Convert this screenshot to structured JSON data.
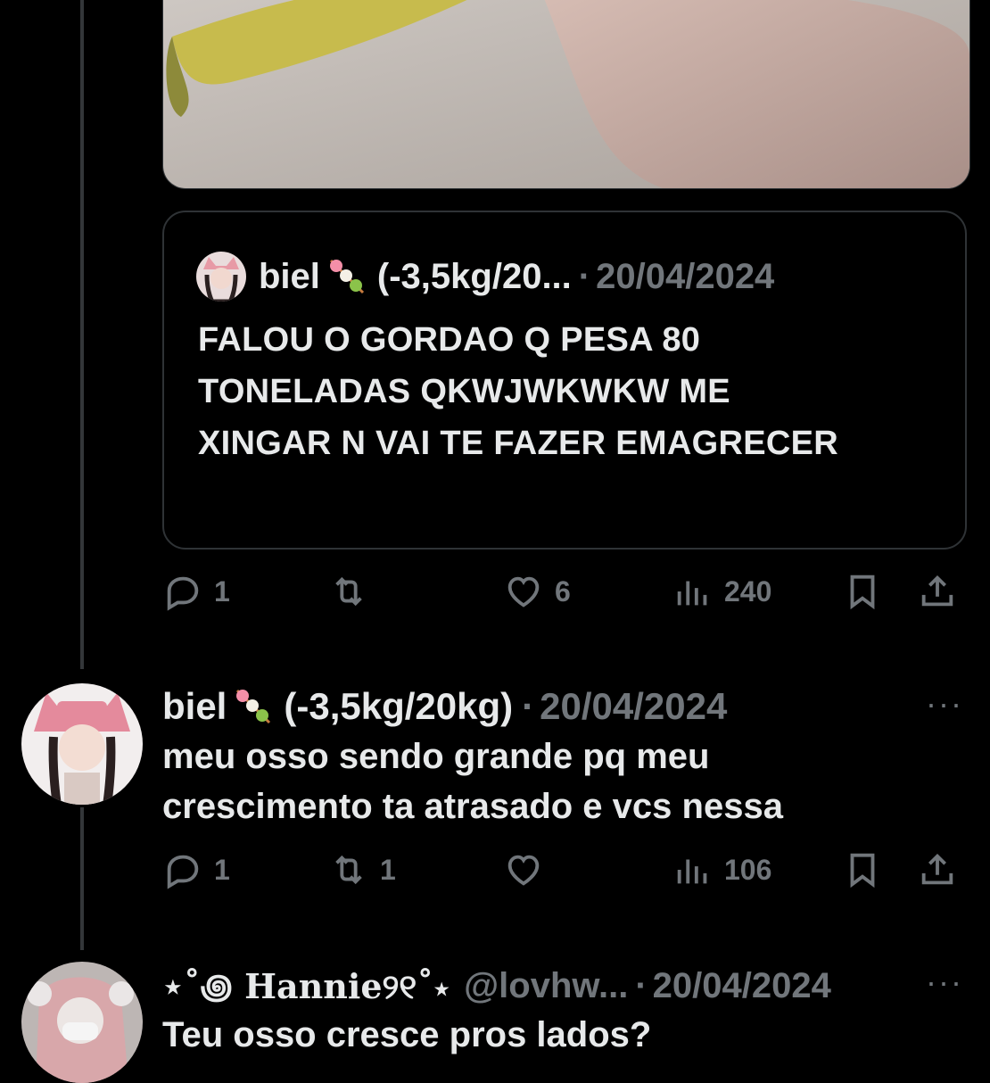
{
  "quote": {
    "name": "biel",
    "handle_truncated": "(-3,5kg/20...",
    "dot": "·",
    "date": "20/04/2024",
    "text": "FALOU O GORDAO Q PESA 80 TONELADAS QKWJWKWKW ME XINGAR N VAI TE FAZER EMAGRECER"
  },
  "actions1": {
    "replies": "1",
    "reposts": "",
    "likes": "6",
    "views": "240"
  },
  "post2": {
    "name": "biel",
    "display_suffix": "(-3,5kg/20kg)",
    "dot": "·",
    "date": "20/04/2024",
    "more": "···",
    "text": "meu osso sendo grande pq meu crescimento ta atrasado e vcs nessa"
  },
  "actions2": {
    "replies": "1",
    "reposts": "1",
    "likes": "",
    "views": "106"
  },
  "post3": {
    "name": "⋆˚꩜ Hannie୨୧˚⋆",
    "handle": "@lovhw...",
    "dot": "·",
    "date": "20/04/2024",
    "more": "···",
    "text": "Teu osso cresce pros lados?"
  },
  "icons": [
    "reply-icon",
    "repost-icon",
    "like-icon",
    "views-icon",
    "bookmark-icon",
    "share-icon",
    "dango-emoji-icon",
    "more-icon"
  ],
  "colors": {
    "background": "#000000",
    "text": "#e7e9ea",
    "muted": "#71767b",
    "border": "#2f3336"
  }
}
